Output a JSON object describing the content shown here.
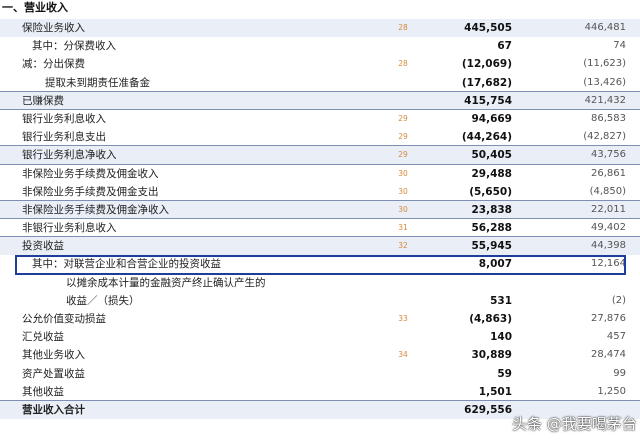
{
  "section": {
    "title": "一、营业收入"
  },
  "rows": [
    {
      "label": "保险业务收入",
      "note": "28",
      "current": "445,505",
      "previous": "446,481",
      "indent": 0,
      "shade": true,
      "sep": false
    },
    {
      "label": "其中：分保费收入",
      "note": "",
      "current": "67",
      "previous": "74",
      "indent": 1,
      "shade": false,
      "sep": false
    },
    {
      "label": "减：分出保费",
      "note": "28",
      "current": "(12,069)",
      "previous": "(11,623)",
      "indent": 0,
      "shade": false,
      "sep": false
    },
    {
      "label": "提取未到期责任准备金",
      "note": "",
      "current": "(17,682)",
      "previous": "(13,426)",
      "indent": 2,
      "shade": false,
      "sep": true
    },
    {
      "label": "已赚保费",
      "note": "",
      "current": "415,754",
      "previous": "421,432",
      "indent": 0,
      "shade": true,
      "sep": true
    },
    {
      "label": "银行业务利息收入",
      "note": "29",
      "current": "94,669",
      "previous": "86,583",
      "indent": 0,
      "shade": false,
      "sep": false
    },
    {
      "label": "银行业务利息支出",
      "note": "29",
      "current": "(44,264)",
      "previous": "(42,827)",
      "indent": 0,
      "shade": false,
      "sep": true
    },
    {
      "label": "银行业务利息净收入",
      "note": "29",
      "current": "50,405",
      "previous": "43,756",
      "indent": 0,
      "shade": true,
      "sep": true
    },
    {
      "label": "非保险业务手续费及佣金收入",
      "note": "30",
      "current": "29,488",
      "previous": "26,861",
      "indent": 0,
      "shade": false,
      "sep": false
    },
    {
      "label": "非保险业务手续费及佣金支出",
      "note": "30",
      "current": "(5,650)",
      "previous": "(4,850)",
      "indent": 0,
      "shade": false,
      "sep": true
    },
    {
      "label": "非保险业务手续费及佣金净收入",
      "note": "30",
      "current": "23,838",
      "previous": "22,011",
      "indent": 0,
      "shade": true,
      "sep": true
    },
    {
      "label": "非银行业务利息收入",
      "note": "31",
      "current": "56,288",
      "previous": "49,402",
      "indent": 0,
      "shade": false,
      "sep": true
    },
    {
      "label": "投资收益",
      "note": "32",
      "current": "55,945",
      "previous": "44,398",
      "indent": 0,
      "shade": true,
      "sep": false
    },
    {
      "label": "其中：对联营企业和合营企业的投资收益",
      "note": "",
      "current": "8,007",
      "previous": "12,164",
      "indent": 1,
      "shade": false,
      "sep": false
    },
    {
      "label": "以摊余成本计量的金融资产终止确认产生的",
      "note": "",
      "current": "",
      "previous": "",
      "indent": 3,
      "shade": false,
      "sep": false
    },
    {
      "label": "收益／（损失）",
      "note": "",
      "current": "531",
      "previous": "(2)",
      "indent": 3,
      "shade": false,
      "sep": false
    },
    {
      "label": "公允价值变动损益",
      "note": "33",
      "current": "(4,863)",
      "previous": "27,876",
      "indent": 0,
      "shade": false,
      "sep": false
    },
    {
      "label": "汇兑收益",
      "note": "",
      "current": "140",
      "previous": "457",
      "indent": 0,
      "shade": false,
      "sep": false
    },
    {
      "label": "其他业务收入",
      "note": "34",
      "current": "30,889",
      "previous": "28,474",
      "indent": 0,
      "shade": false,
      "sep": false
    },
    {
      "label": "资产处置收益",
      "note": "",
      "current": "59",
      "previous": "99",
      "indent": 0,
      "shade": false,
      "sep": false
    },
    {
      "label": "其他收益",
      "note": "",
      "current": "1,501",
      "previous": "1,250",
      "indent": 0,
      "shade": false,
      "sep": true
    },
    {
      "label": "营业收入合计",
      "note": "",
      "current": "629,556",
      "previous": "",
      "indent": 0,
      "shade": true,
      "sep": false,
      "total": true
    }
  ],
  "watermark": {
    "text": "头条 @我要喝茅台"
  }
}
